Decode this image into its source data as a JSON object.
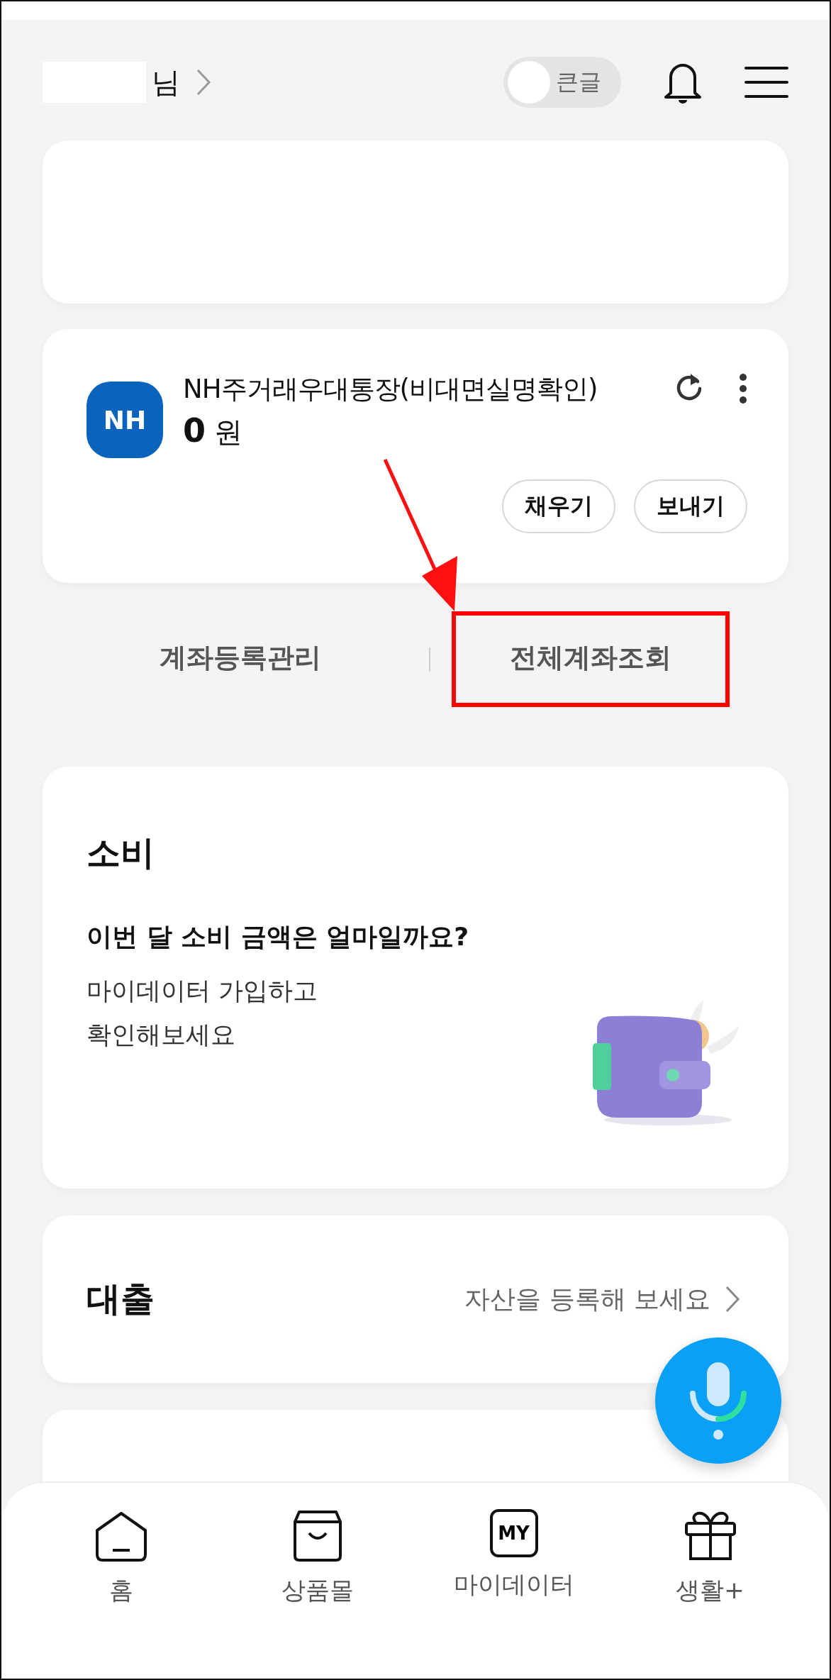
{
  "header": {
    "suffix": "님",
    "large_text_toggle": {
      "label": "큰글",
      "on": false
    }
  },
  "account": {
    "bank_logo": "NH",
    "name": "NH주거래우대통장(비대면실명확인)",
    "amount": "0",
    "unit": "원",
    "buttons": [
      "채우기",
      "보내기"
    ]
  },
  "account_links": [
    {
      "label": "계좌등록관리",
      "highlighted": false
    },
    {
      "label": "전체계좌조회",
      "highlighted": true
    }
  ],
  "spending": {
    "title": "소비",
    "question": "이번 달 소비 금액은 얼마일까요?",
    "description_lines": [
      "마이데이터 가입하고",
      "확인해보세요"
    ]
  },
  "loan": {
    "title": "대출",
    "action": "자산을 등록해 보세요"
  },
  "bottom_nav": [
    {
      "label": "홈",
      "kind": "home"
    },
    {
      "label": "상품몰",
      "kind": "shop"
    },
    {
      "label": "마이데이터",
      "kind": "my",
      "icon_text": "MY"
    },
    {
      "label": "생활+",
      "kind": "gift"
    }
  ]
}
